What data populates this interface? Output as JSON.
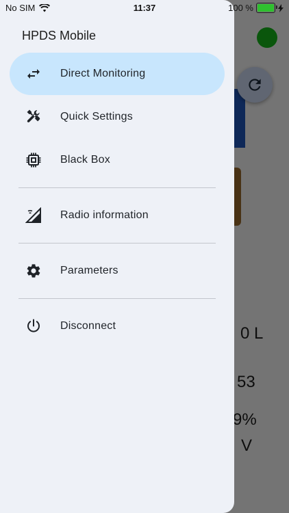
{
  "status_bar": {
    "carrier": "No SIM",
    "time": "11:37",
    "battery": "100 %"
  },
  "drawer": {
    "title": "HPDS Mobile",
    "items": [
      {
        "label": "Direct Monitoring",
        "icon": "swap-arrows-icon",
        "active": true
      },
      {
        "label": "Quick Settings",
        "icon": "tools-icon"
      },
      {
        "label": "Black Box",
        "icon": "chip-icon"
      },
      {
        "label": "Radio information",
        "icon": "signal-cellular-icon"
      },
      {
        "label": "Parameters",
        "icon": "gear-icon"
      },
      {
        "label": "Disconnect",
        "icon": "power-icon"
      }
    ]
  },
  "background_app": {
    "values": [
      "0 L",
      "53",
      "9%",
      "V"
    ]
  },
  "colors": {
    "active_item": "#c8e6fd",
    "drawer_bg": "#eef1f7",
    "status_online": "#16b41a"
  }
}
